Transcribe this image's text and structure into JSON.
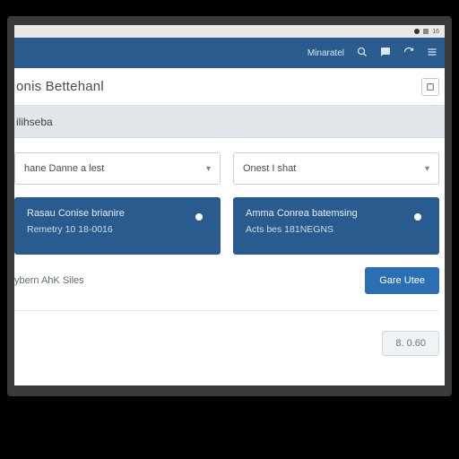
{
  "status": {
    "time": "16"
  },
  "nav": {
    "link": "Minaratel"
  },
  "title": "onis Bettehanl",
  "section": "ilihseba",
  "selects": [
    {
      "label": "hane Danne a lest"
    },
    {
      "label": "Onest I shat"
    }
  ],
  "cards": [
    {
      "title": "Rasau Conise brianire",
      "sub": "Remetry  10 18-0016"
    },
    {
      "title": "Amma Conrea batemsing",
      "sub": "Acts bes  181NEGNS"
    }
  ],
  "summary": {
    "label": "ybern AhK Siles"
  },
  "button": {
    "label": "Gare Utee"
  },
  "price": {
    "value": "8. 0.60"
  }
}
